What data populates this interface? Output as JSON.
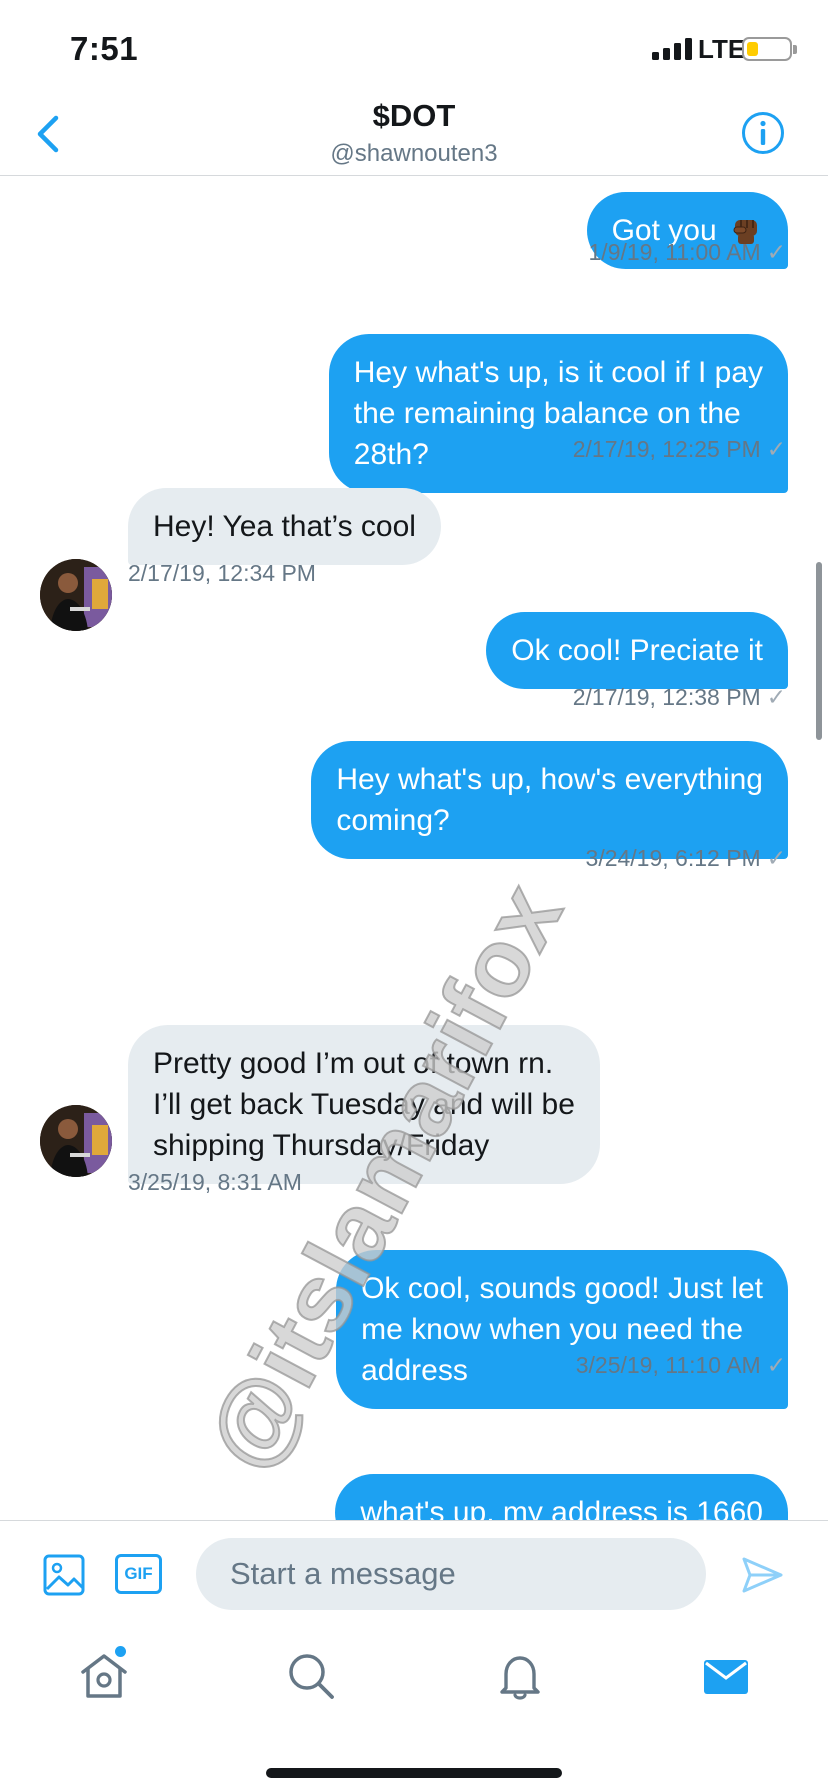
{
  "status_bar": {
    "time": "7:51",
    "network": "LTE",
    "battery_level": 0.25,
    "battery_color": "#ffcc00"
  },
  "header": {
    "title": "$DOT",
    "handle": "@shawnouten3",
    "back_icon": "chevron-left-icon",
    "info_icon": "info-icon"
  },
  "messages": [
    {
      "direction": "out",
      "text": "Got you",
      "emoji": "raised-fist-icon",
      "time": "1/9/19, 11:00 AM"
    },
    {
      "direction": "out",
      "lines": [
        "Hey what's up, is it cool if I pay",
        "the remaining balance on the",
        "28th?"
      ],
      "time": "2/17/19, 12:25 PM"
    },
    {
      "direction": "in",
      "text": "Hey! Yea that’s cool",
      "time": "2/17/19, 12:34 PM"
    },
    {
      "direction": "out",
      "text": "Ok cool! Preciate it",
      "time": "2/17/19, 12:38 PM"
    },
    {
      "direction": "out",
      "lines": [
        "Hey what's up, how's everything",
        "coming?"
      ],
      "time": "3/24/19, 6:12 PM"
    },
    {
      "direction": "in",
      "lines": [
        "Pretty good I’m out of town rn.",
        "I’ll get back Tuesday and will be",
        "shipping Thursday/Friday"
      ],
      "time": "3/25/19, 8:31 AM"
    },
    {
      "direction": "out",
      "lines": [
        "Ok cool, sounds good! Just let",
        "me know when you need the",
        "address"
      ],
      "time": "3/25/19, 11:10 AM"
    },
    {
      "direction": "out",
      "text": "what's up, my address is 1660"
    }
  ],
  "read_mark": "✓",
  "watermark": "@itslamarifox",
  "composer": {
    "placeholder": "Start a message",
    "media_icon": "image-icon",
    "gif_label": "GIF",
    "send_icon": "send-icon"
  },
  "tabs": [
    {
      "name": "home",
      "icon": "home-icon",
      "has_badge": true
    },
    {
      "name": "search",
      "icon": "search-icon"
    },
    {
      "name": "notifications",
      "icon": "bell-icon"
    },
    {
      "name": "messages",
      "icon": "mail-icon",
      "active": true
    }
  ],
  "colors": {
    "accent": "#1da1f2",
    "incoming_bubble": "#e6ecf0",
    "secondary_text": "#657786"
  }
}
